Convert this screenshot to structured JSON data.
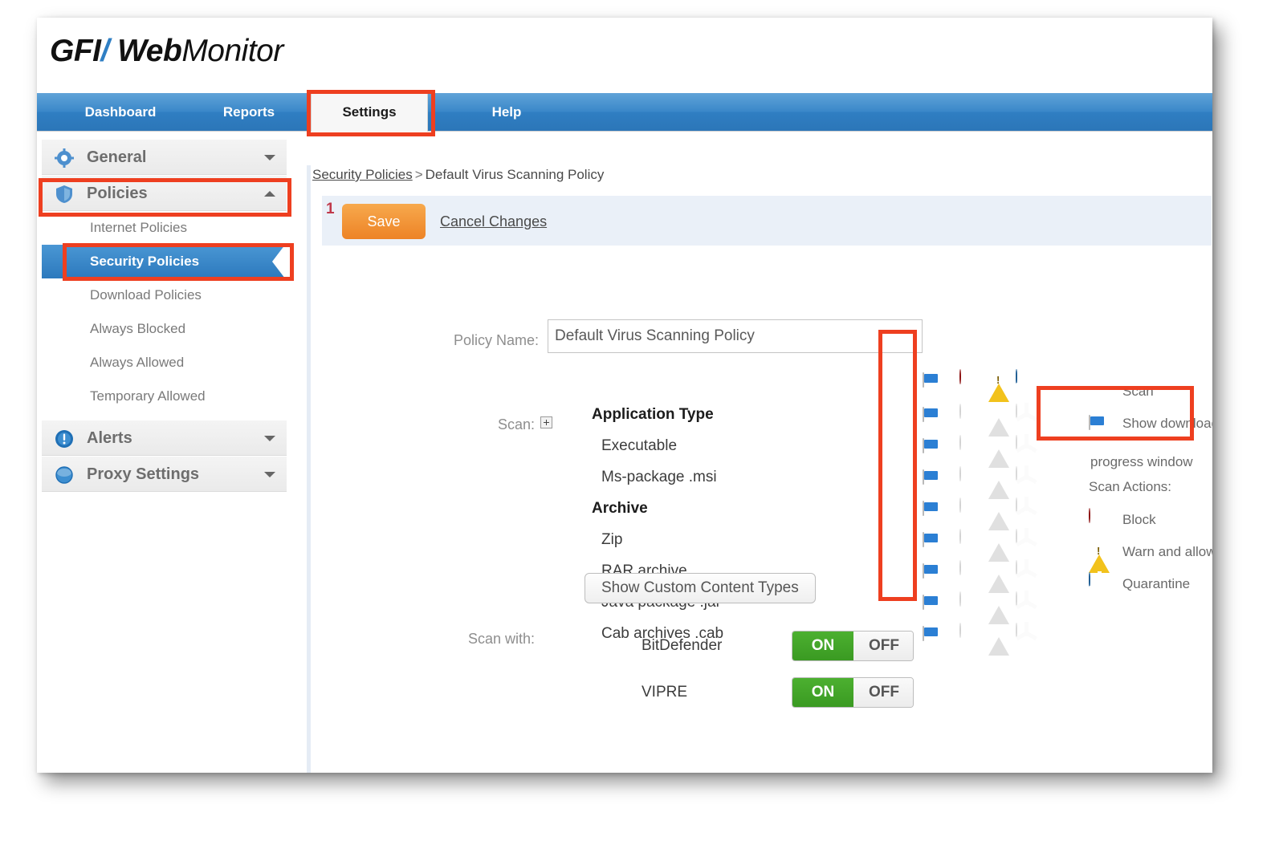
{
  "brand": {
    "gfi": "GFI",
    "web": "Web",
    "monitor": "Monitor"
  },
  "topnav": {
    "tabs": [
      {
        "label": "Dashboard",
        "active": false
      },
      {
        "label": "Reports",
        "active": false
      },
      {
        "label": "Settings",
        "active": true
      },
      {
        "label": "Help",
        "active": false
      }
    ]
  },
  "sidebar": {
    "groups": [
      {
        "label": "General",
        "icon": "gear-icon",
        "expanded": false
      },
      {
        "label": "Policies",
        "icon": "shield-icon",
        "expanded": true
      },
      {
        "label": "Alerts",
        "icon": "alert-icon",
        "expanded": false
      },
      {
        "label": "Proxy Settings",
        "icon": "globe-icon",
        "expanded": false
      }
    ],
    "policy_items": [
      {
        "label": "Internet Policies",
        "selected": false
      },
      {
        "label": "Security Policies",
        "selected": true
      },
      {
        "label": "Download Policies",
        "selected": false
      },
      {
        "label": "Always Blocked",
        "selected": false
      },
      {
        "label": "Always Allowed",
        "selected": false
      },
      {
        "label": "Temporary Allowed",
        "selected": false
      }
    ]
  },
  "breadcrumb": {
    "root": "Security Policies",
    "separator": ">",
    "current": "Default Virus Scanning Policy"
  },
  "toolbar": {
    "marker": "1",
    "save_label": "Save",
    "cancel_label": "Cancel Changes"
  },
  "form": {
    "policy_name_label": "Policy Name:",
    "policy_name_value": "Default Virus Scanning Policy",
    "policy_name_placeholder": "Policy Name",
    "scan_label": "Scan:",
    "scan_with_label": "Scan with:",
    "custom_types_button": "Show Custom Content Types"
  },
  "scan_grid": {
    "header_icons": [
      "scan-shield-icon",
      "download-progress-icon",
      "block-icon",
      "warn-icon",
      "quarantine-icon"
    ],
    "rows": [
      {
        "label": "Application Type",
        "bold": true,
        "indent": false,
        "scan": true,
        "progress": true,
        "block": false,
        "warn": false,
        "quarantine": false
      },
      {
        "label": "Executable",
        "bold": false,
        "indent": true,
        "scan": true,
        "progress": true,
        "block": false,
        "warn": false,
        "quarantine": false
      },
      {
        "label": "Ms-package .msi",
        "bold": false,
        "indent": true,
        "scan": true,
        "progress": true,
        "block": false,
        "warn": false,
        "quarantine": false
      },
      {
        "label": "Archive",
        "bold": true,
        "indent": false,
        "scan": true,
        "progress": true,
        "block": false,
        "warn": false,
        "quarantine": false
      },
      {
        "label": "Zip",
        "bold": false,
        "indent": true,
        "scan": true,
        "progress": true,
        "block": false,
        "warn": false,
        "quarantine": false
      },
      {
        "label": "RAR archive",
        "bold": false,
        "indent": true,
        "scan": true,
        "progress": true,
        "block": false,
        "warn": false,
        "quarantine": false
      },
      {
        "label": "Java package .jar",
        "bold": false,
        "indent": true,
        "scan": true,
        "progress": true,
        "block": false,
        "warn": false,
        "quarantine": false
      },
      {
        "label": "Cab archives .cab",
        "bold": false,
        "indent": true,
        "scan": true,
        "progress": true,
        "block": false,
        "warn": false,
        "quarantine": false
      }
    ]
  },
  "legend": {
    "scan_label": "Scan",
    "download_label_line1": "Show download",
    "download_label_line2": "progress window",
    "actions_title": "Scan Actions:",
    "block_label": "Block",
    "warn_label": "Warn and allow",
    "quarantine_label": "Quarantine"
  },
  "engines": [
    {
      "name": "BitDefender",
      "logo": "bitdefender-logo",
      "on_label": "ON",
      "off_label": "OFF",
      "state": "ON"
    },
    {
      "name": "VIPRE",
      "logo": "vipre-logo",
      "on_label": "ON",
      "off_label": "OFF",
      "state": "ON"
    }
  ],
  "colors": {
    "nav_blue": "#2f7ec2",
    "selected_blue": "#2c79bd",
    "save_orange": "#ed8326",
    "annotation_red": "#ee3f20",
    "toggle_green": "#3a9a22",
    "scan_green": "#3f8b3a",
    "block_red": "#b81c1c",
    "warn_yellow": "#f2c21c",
    "quarantine_blue": "#2f7fc4"
  }
}
